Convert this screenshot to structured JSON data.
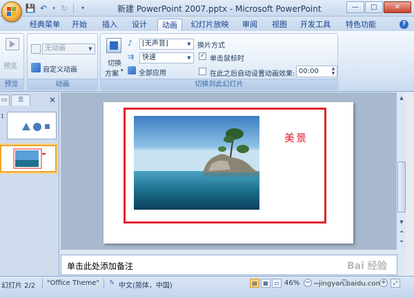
{
  "window": {
    "title": "新建 PowerPoint 2007.pptx - Microsoft PowerPoint",
    "controls": [
      "—",
      "□",
      "✕"
    ]
  },
  "tabs": [
    "经典菜单",
    "开始",
    "插入",
    "设计",
    "动画",
    "幻灯片放映",
    "审阅",
    "视图",
    "开发工具",
    "特色功能"
  ],
  "active_tab": "动画",
  "ribbon": {
    "preview_group": {
      "label": "预览",
      "button": "预览"
    },
    "animation_group": {
      "label": "动画",
      "effect_combo": "无动画",
      "custom_animation": "自定义动画"
    },
    "transition_group": {
      "label": "切换到此幻灯片",
      "scheme_label": "切换",
      "scheme_label2": "方案",
      "sound_combo": "[无声音]",
      "speed_combo": "快速",
      "apply_all": "全部应用",
      "advance_title": "换片方式",
      "on_click": "单击鼠标时",
      "on_click_checked": true,
      "auto_after": "在此之后自动设置动画效果:",
      "auto_after_checked": false,
      "auto_time": "00:00"
    }
  },
  "slides_panel": {
    "slides": [
      {
        "number": "1"
      },
      {
        "number": "2",
        "selected": true
      }
    ]
  },
  "slide": {
    "caption": "美景"
  },
  "notes": {
    "placeholder": "单击此处添加备注"
  },
  "watermark": "Bai 经验",
  "status": {
    "slide_counter": "幻灯片 2/2",
    "theme": "\"Office Theme\"",
    "language": "中文(简体，中国)",
    "zoom": "46%",
    "url": "jingyan.baidu.com"
  },
  "colors": {
    "accent_red": "#e3212b",
    "selection": "#f0a42c"
  }
}
